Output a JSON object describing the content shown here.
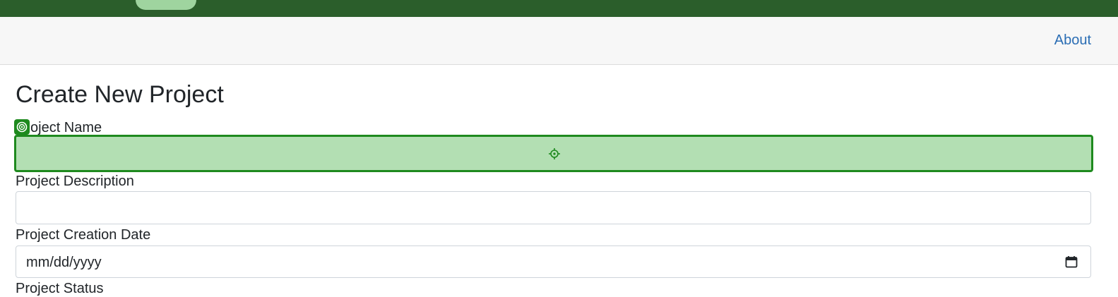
{
  "nav": {
    "about_label": "About"
  },
  "page": {
    "title": "Create New Project"
  },
  "form": {
    "project_name_label": "oject Name",
    "project_name_value": "",
    "project_description_label": "Project Description",
    "project_description_value": "",
    "creation_date_label": "Project Creation Date",
    "creation_date_placeholder": "mm/dd/yyyy",
    "status_label": "Project Status"
  },
  "colors": {
    "topbar": "#2b5e2b",
    "highlight_fill": "#b3dfb3",
    "highlight_border": "#1e8a1e",
    "link": "#2a6db4"
  },
  "icons": {
    "crosshair": "crosshair-icon",
    "marker": "target-marker-icon",
    "calendar": "calendar-icon"
  }
}
